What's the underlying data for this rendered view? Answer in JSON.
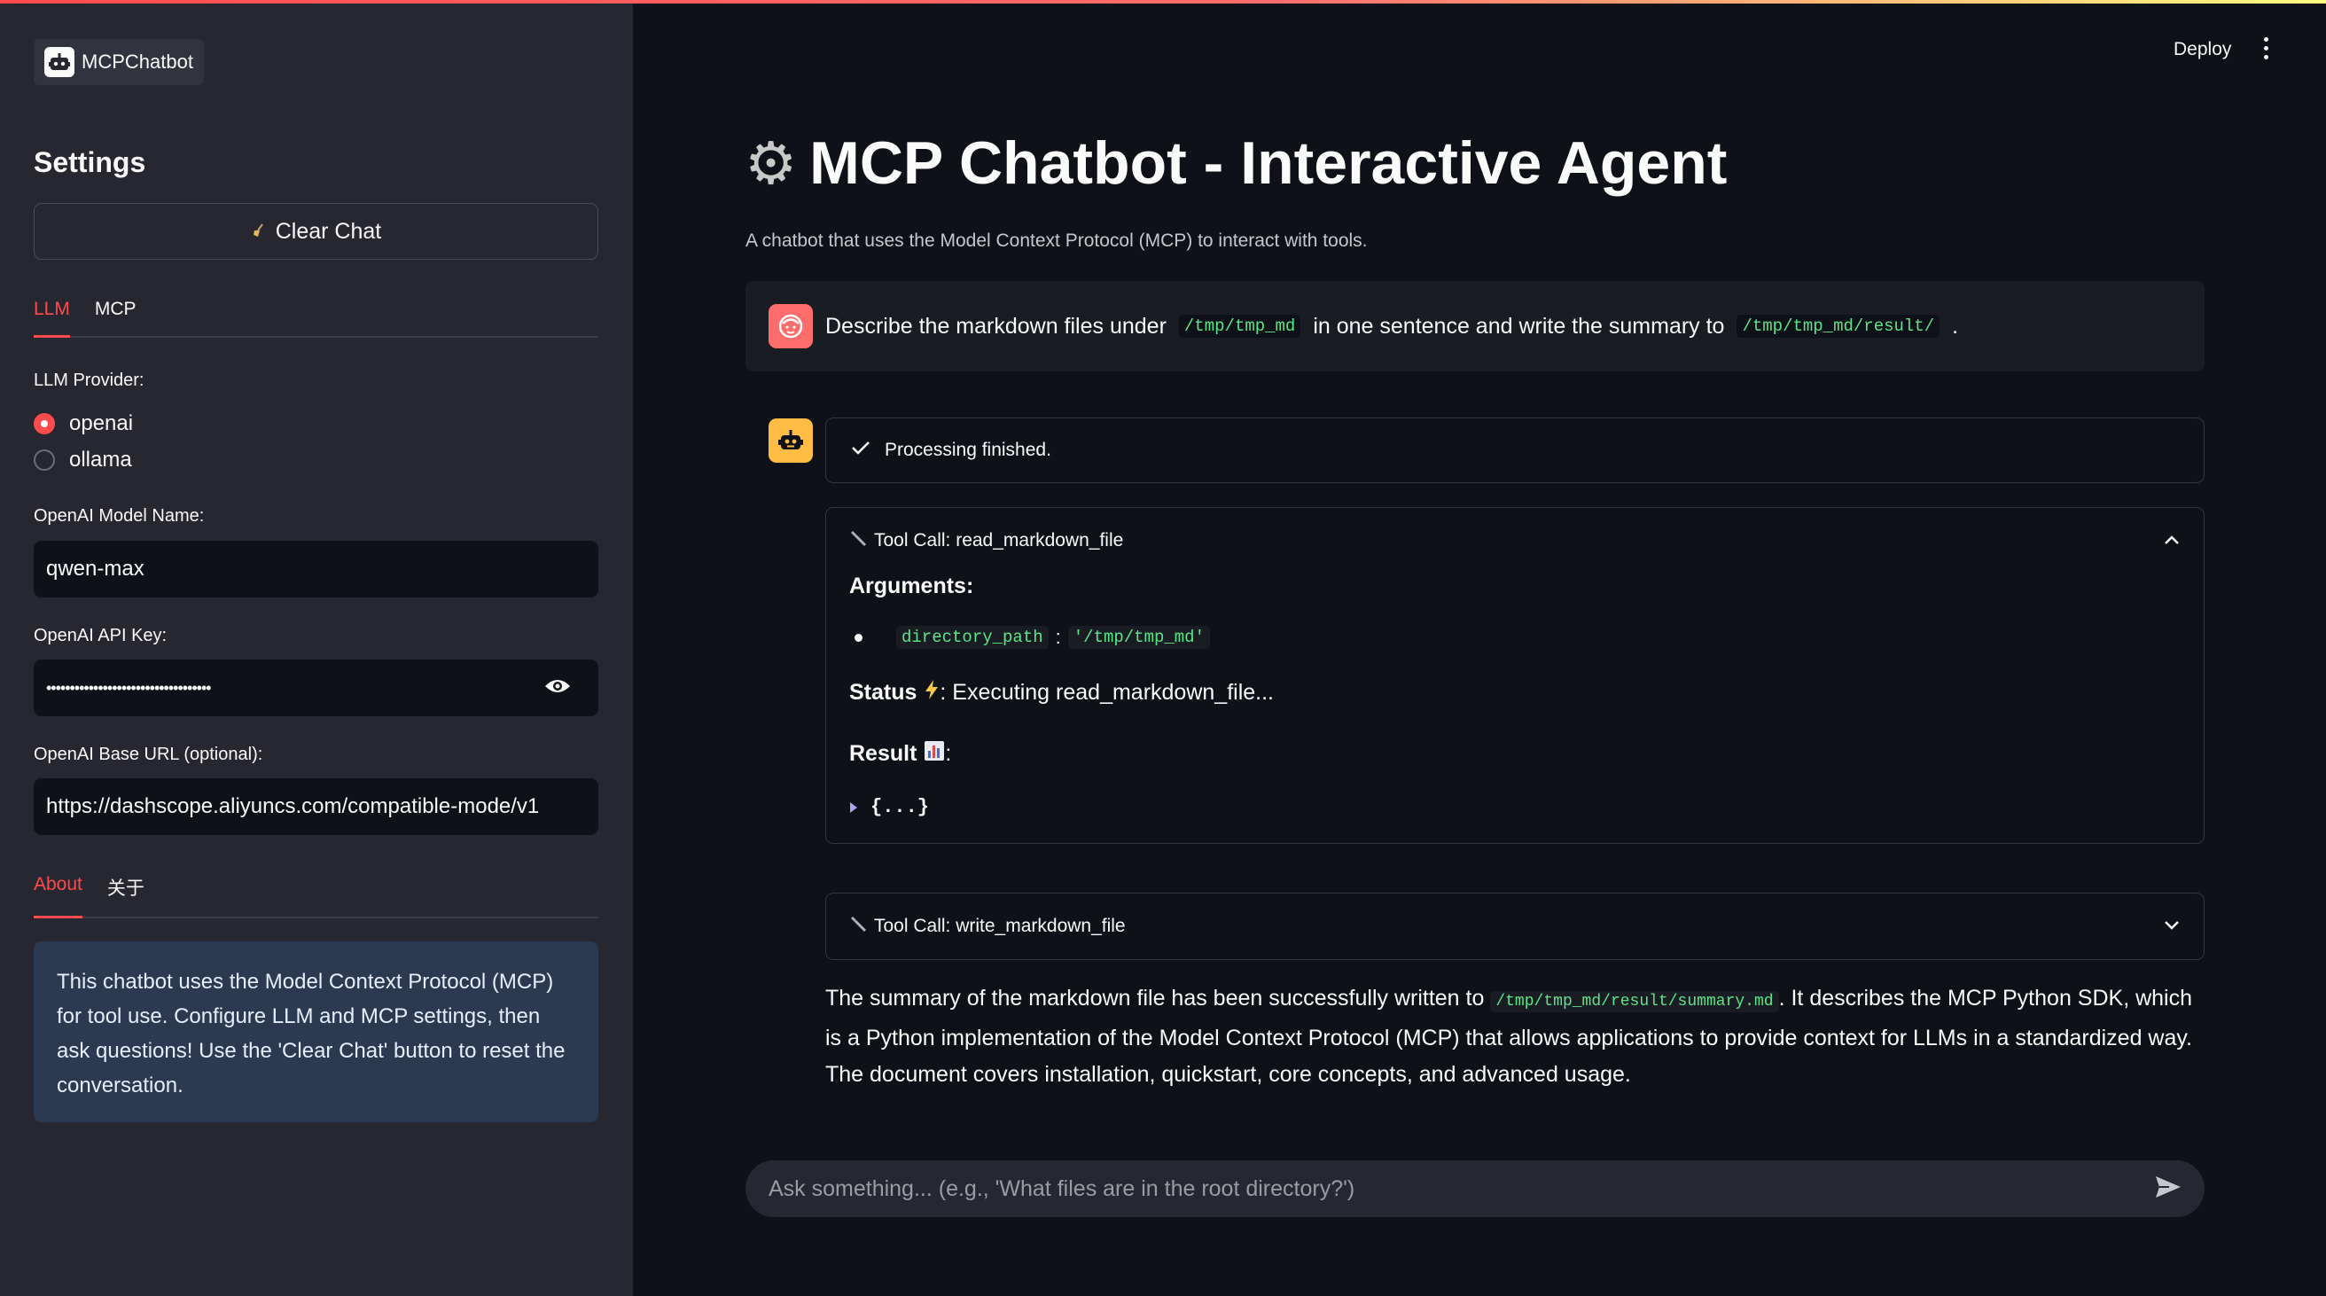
{
  "sidebar": {
    "logo_text": "MCPChatbot",
    "settings_title": "Settings",
    "clear_chat_label": "Clear Chat",
    "tabs": [
      {
        "label": "LLM"
      },
      {
        "label": "MCP"
      }
    ],
    "provider_label": "LLM Provider:",
    "providers": [
      {
        "label": "openai",
        "selected": true
      },
      {
        "label": "ollama",
        "selected": false
      }
    ],
    "model_name_label": "OpenAI Model Name:",
    "model_name_value": "qwen-max",
    "api_key_label": "OpenAI API Key:",
    "api_key_value": "•••••••••••••••••••••••••••••••••••",
    "base_url_label": "OpenAI Base URL (optional):",
    "base_url_value": "https://dashscope.aliyuncs.com/compatible-mode/v1",
    "about_tabs": [
      {
        "label": "About"
      },
      {
        "label": "关于"
      }
    ],
    "about_text": "This chatbot uses the Model Context Protocol (MCP) for tool use. Configure LLM and MCP settings, then ask questions! Use the 'Clear Chat' button to reset the conversation."
  },
  "header": {
    "deploy_label": "Deploy"
  },
  "main": {
    "title": "MCP Chatbot - Interactive Agent",
    "subtitle": "A chatbot that uses the Model Context Protocol (MCP) to interact with tools.",
    "user_message": {
      "part1": "Describe the markdown files under",
      "code1": "/tmp/tmp_md",
      "part2": "in one sentence and write the summary to",
      "code2": "/tmp/tmp_md/result/",
      "part3": "."
    },
    "status_text": "Processing finished.",
    "tool_call_1": {
      "header": "Tool Call: read_markdown_file",
      "arguments_label": "Arguments:",
      "arg_key": "directory_path",
      "arg_value": "'/tmp/tmp_md'",
      "status_label": "Status",
      "status_text": ": Executing read_markdown_file...",
      "result_label": "Result",
      "result_preview": "{...}"
    },
    "tool_call_2": {
      "header": "Tool Call: write_markdown_file"
    },
    "summary": {
      "part1": "The summary of the markdown file has been successfully written to",
      "code": "/tmp/tmp_md/result/summary.md",
      "part2": ". It describes the MCP Python SDK, which is a Python implementation of the Model Context Protocol (MCP) that allows applications to provide context for LLMs in a standardized way. The document covers installation, quickstart, core concepts, and advanced usage."
    },
    "chat_input_placeholder": "Ask something... (e.g., 'What files are in the root directory?')"
  },
  "colors": {
    "accent": "#ff4b4b",
    "code_green": "#5ce488",
    "info_bg": "#2b3a51",
    "bot_avatar": "#ffbd45",
    "user_avatar": "#ff6c6c"
  }
}
